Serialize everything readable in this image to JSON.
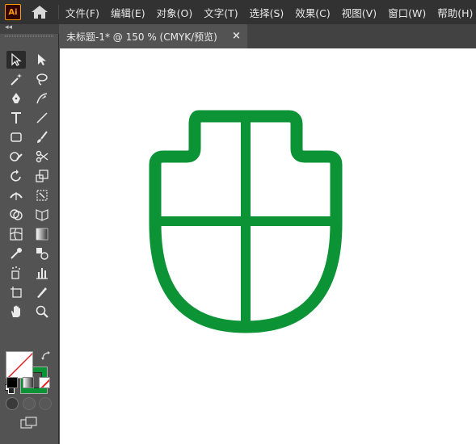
{
  "app": {
    "logo_text": "Ai",
    "logo_color": "#ff9a00",
    "logo_bg": "#330000"
  },
  "menu": {
    "items": [
      "文件(F)",
      "编辑(E)",
      "对象(O)",
      "文字(T)",
      "选择(S)",
      "效果(C)",
      "视图(V)",
      "窗口(W)",
      "帮助(H)"
    ]
  },
  "document": {
    "tab_label": "未标题-1* @ 150 % (CMYK/预览)",
    "close_glyph": "×"
  },
  "toolbar": {
    "collapse_glyph": "◂◂",
    "tools": [
      "selection",
      "direct-selection",
      "magic-wand",
      "lasso",
      "pen",
      "curvature",
      "type",
      "line-segment",
      "rectangle",
      "paintbrush",
      "shaper",
      "scissors",
      "rotate",
      "scale",
      "width",
      "free-transform",
      "shape-builder",
      "perspective-grid",
      "mesh",
      "gradient",
      "eyedropper",
      "blend",
      "symbol-sprayer",
      "column-graph",
      "artboard",
      "slice",
      "hand",
      "zoom"
    ],
    "active_tool": "selection",
    "fill_color": "#ffffff",
    "stroke_color": "#0b9336"
  },
  "artwork": {
    "stroke_color": "#0b9336",
    "shape": "shield"
  }
}
